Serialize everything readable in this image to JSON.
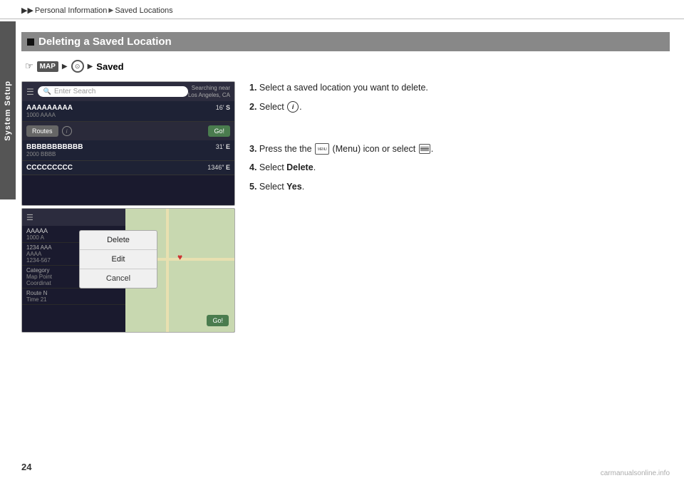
{
  "breadcrumb": {
    "arrows": "▶▶",
    "part1": "Personal Information",
    "arrow2": "▶",
    "part2": "Saved Locations"
  },
  "sidebar": {
    "label": "System Setup"
  },
  "page_number": "24",
  "section": {
    "heading": "Deleting a Saved Location"
  },
  "nav_path": {
    "finger": "☞",
    "map_label": "MAP",
    "saved": "Saved"
  },
  "screenshot_top": {
    "search_placeholder": "Enter Search",
    "searching_near": "Searching near",
    "location": "Los Angeles, CA",
    "item1_name": "AAAAAAAAA",
    "item1_sub": "1000 AAAA",
    "item1_dist": "16",
    "item1_dir": "S",
    "routes_label": "Routes",
    "go_label": "Go!",
    "item2_name": "BBBBBBBBBBB",
    "item2_sub": "2000 BBBB",
    "item2_dist": "31",
    "item2_dir": "E",
    "item3_name": "CCCCCCCCC",
    "item3_dist": "1346",
    "item3_dir": "E"
  },
  "screenshot_bottom": {
    "item_name": "AAAAA",
    "item_sub1": "1000 A",
    "item_sub2": "1234 AAA",
    "item_sub3": "AAAA",
    "item_sub4": "1234-567",
    "category_label": "Category",
    "map_point": "Map Point",
    "coordinate": "Coordinat",
    "route_label": "Route N",
    "time_label": "Time 21",
    "menu_delete": "Delete",
    "menu_edit": "Edit",
    "menu_cancel": "Cancel"
  },
  "instructions": {
    "step1": "Select a saved location you want to delete.",
    "step2_prefix": "Select",
    "step3_prefix": "Press the",
    "step3_menu_label": "(Menu) icon or select",
    "step4_prefix": "Select",
    "step4_action": "Delete",
    "step5_prefix": "Select",
    "step5_action": "Yes"
  },
  "watermark": "carmanualsonline.info"
}
